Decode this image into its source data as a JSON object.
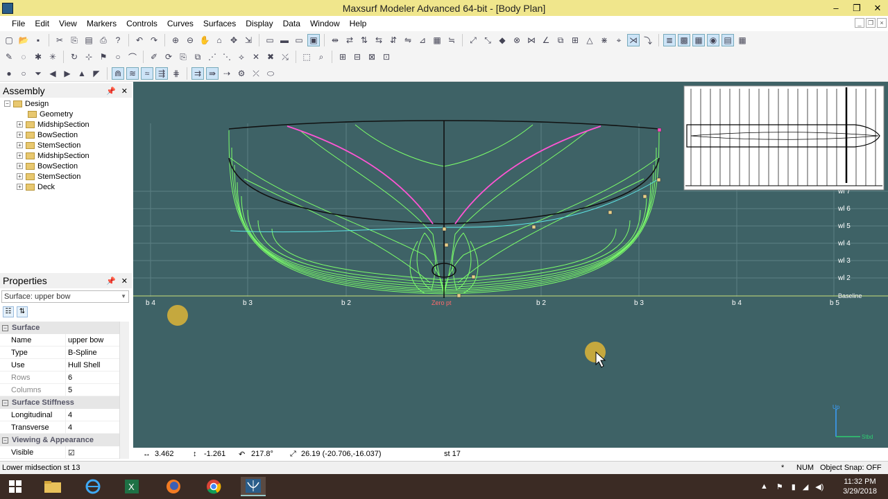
{
  "window": {
    "title": "Maxsurf Modeler Advanced 64-bit - [Body Plan]",
    "controls": [
      "–",
      "❐",
      "✕"
    ]
  },
  "menu": [
    "File",
    "Edit",
    "View",
    "Markers",
    "Controls",
    "Curves",
    "Surfaces",
    "Display",
    "Data",
    "Window",
    "Help"
  ],
  "assembly": {
    "title": "Assembly",
    "root": "Design",
    "items": [
      "Geometry",
      "MidshipSection",
      "BowSection",
      "StemSection",
      "MidshipSection",
      "BowSection",
      "StemSection",
      "Deck"
    ]
  },
  "properties": {
    "title": "Properties",
    "selected": "Surface: upper bow",
    "categories": {
      "surface": "Surface",
      "stiffness": "Surface Stiffness",
      "viewing": "Viewing & Appearance"
    },
    "rows": {
      "name": {
        "key": "Name",
        "value": "upper bow"
      },
      "type": {
        "key": "Type",
        "value": "B-Spline"
      },
      "use": {
        "key": "Use",
        "value": "Hull Shell"
      },
      "rows": {
        "key": "Rows",
        "value": "6"
      },
      "columns": {
        "key": "Columns",
        "value": "5"
      },
      "longitudinal": {
        "key": "Longitudinal",
        "value": "4"
      },
      "transverse": {
        "key": "Transverse",
        "value": "4"
      },
      "visible": {
        "key": "Visible",
        "value": "☑"
      }
    }
  },
  "body_plan": {
    "buttock_labels": [
      "b 4",
      "b 3",
      "b 2",
      "b 2",
      "b 3",
      "b 4",
      "b 5"
    ],
    "waterline_labels": [
      "wl 7",
      "wl 6",
      "wl 5",
      "wl 4",
      "wl 3",
      "wl 2"
    ],
    "baseline_label": "Baseline",
    "zero_label": "Zero pt",
    "axis_up": "Up",
    "axis_stbd": "Stbd"
  },
  "coords": {
    "x": "3.462",
    "y": "-1.261",
    "angle": "217.8°",
    "dist": "26.19 (-20.706,-16.037)",
    "station": "st 17"
  },
  "status": {
    "message": "Lower midsection st 13",
    "star": "*",
    "num": "NUM",
    "snap": "Object Snap: OFF"
  },
  "taskbar": {
    "time": "11:32 PM",
    "date": "3/29/2018"
  },
  "colors": {
    "canvas": "#3e6266",
    "station_lines": "#7cff6a",
    "selected_curve": "#ff55d4",
    "titlebar": "#f0e68c"
  }
}
